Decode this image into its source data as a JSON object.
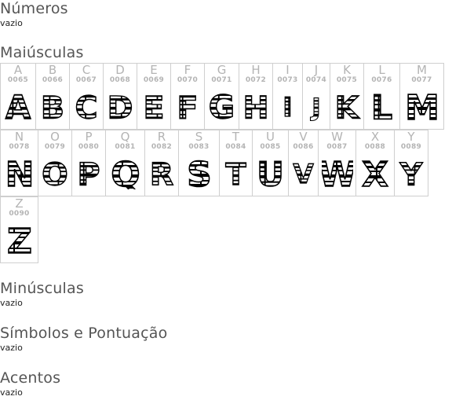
{
  "sections": [
    {
      "title": "Números",
      "status": "vazio"
    },
    {
      "title": "Maiúsculas",
      "status": ""
    },
    {
      "title": "Minúsculas",
      "status": "vazio"
    },
    {
      "title": "Símbolos e Pontuação",
      "status": "vazio"
    },
    {
      "title": "Acentos",
      "status": "vazio"
    }
  ],
  "uppercase_glyphs": [
    {
      "char": "A",
      "code": "0065"
    },
    {
      "char": "B",
      "code": "0066"
    },
    {
      "char": "C",
      "code": "0067"
    },
    {
      "char": "D",
      "code": "0068"
    },
    {
      "char": "E",
      "code": "0069"
    },
    {
      "char": "F",
      "code": "0070"
    },
    {
      "char": "G",
      "code": "0071"
    },
    {
      "char": "H",
      "code": "0072"
    },
    {
      "char": "I",
      "code": "0073"
    },
    {
      "char": "J",
      "code": "0074"
    },
    {
      "char": "K",
      "code": "0075"
    },
    {
      "char": "L",
      "code": "0076"
    },
    {
      "char": "M",
      "code": "0077"
    },
    {
      "char": "N",
      "code": "0078"
    },
    {
      "char": "O",
      "code": "0079"
    },
    {
      "char": "P",
      "code": "0080"
    },
    {
      "char": "Q",
      "code": "0081"
    },
    {
      "char": "R",
      "code": "0082"
    },
    {
      "char": "S",
      "code": "0083"
    },
    {
      "char": "T",
      "code": "0084"
    },
    {
      "char": "U",
      "code": "0085"
    },
    {
      "char": "V",
      "code": "0086"
    },
    {
      "char": "W",
      "code": "0087"
    },
    {
      "char": "X",
      "code": "0088"
    },
    {
      "char": "Y",
      "code": "0089"
    },
    {
      "char": "Z",
      "code": "0090"
    }
  ]
}
